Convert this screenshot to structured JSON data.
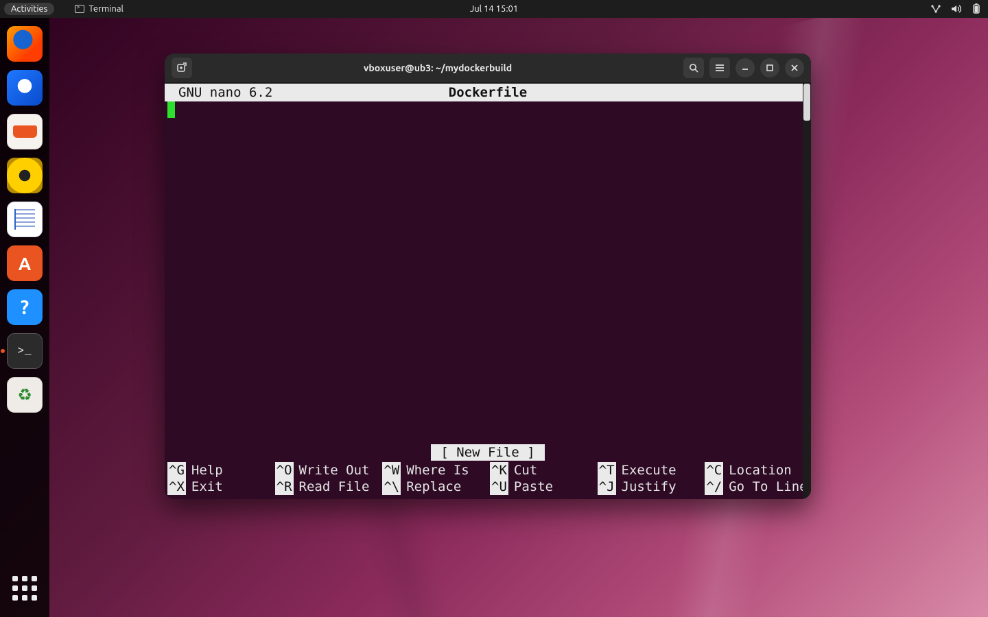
{
  "top_panel": {
    "activities": "Activities",
    "app_name": "Terminal",
    "clock": "Jul 14  15:01"
  },
  "dock": {
    "items": [
      {
        "id": "firefox",
        "name": "firefox-icon"
      },
      {
        "id": "thunderbird",
        "name": "thunderbird-icon"
      },
      {
        "id": "files",
        "name": "files-icon"
      },
      {
        "id": "rhythmbox",
        "name": "rhythmbox-icon"
      },
      {
        "id": "writer",
        "name": "libreoffice-writer-icon"
      },
      {
        "id": "software",
        "name": "ubuntu-software-icon"
      },
      {
        "id": "help",
        "name": "help-icon"
      },
      {
        "id": "terminal",
        "name": "terminal-icon",
        "active": true
      },
      {
        "id": "trash",
        "name": "trash-icon"
      }
    ]
  },
  "terminal_window": {
    "title": "vboxuser@ub3: ~/mydockerbuild"
  },
  "nano": {
    "editor_name": "GNU nano 6.2",
    "file_name": "Dockerfile",
    "buffer": "",
    "status": "[ New File ]",
    "shortcuts": [
      {
        "key": "^G",
        "label": "Help"
      },
      {
        "key": "^X",
        "label": "Exit"
      },
      {
        "key": "^O",
        "label": "Write Out"
      },
      {
        "key": "^R",
        "label": "Read File"
      },
      {
        "key": "^W",
        "label": "Where Is"
      },
      {
        "key": "^\\",
        "label": "Replace"
      },
      {
        "key": "^K",
        "label": "Cut"
      },
      {
        "key": "^U",
        "label": "Paste"
      },
      {
        "key": "^T",
        "label": "Execute"
      },
      {
        "key": "^J",
        "label": "Justify"
      },
      {
        "key": "^C",
        "label": "Location"
      },
      {
        "key": "^/",
        "label": "Go To Line"
      }
    ]
  }
}
